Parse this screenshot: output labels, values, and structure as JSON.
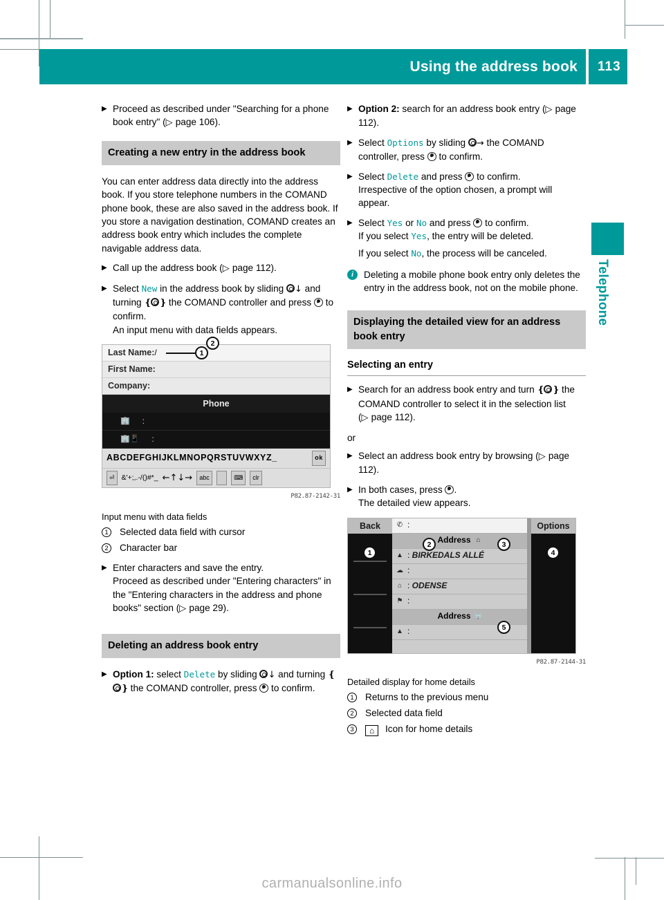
{
  "header": {
    "title": "Using the address book",
    "page_number": "113",
    "accent_color": "#009999"
  },
  "side_tab": {
    "label": "Telephone"
  },
  "watermark": "carmanualsonline.info",
  "left_column": {
    "step_proceed": {
      "line1": "Proceed as described under \"Searching for",
      "line2_pre": "a phone book entry\" (",
      "ref": "page 106",
      "line2_post": ")."
    },
    "section_create": "Creating a new entry in the address book",
    "intro_paragraph": "You can enter address data directly into the address book. If you store telephone numbers in the COMAND phone book, these are also saved in the address book. If you store a navigation destination, COMAND creates an address book entry which includes the complete navigable address data.",
    "step_callup_pre": "Call up the address book (",
    "step_callup_ref": "page 112",
    "step_callup_post": ").",
    "step_new": {
      "pre": "Select ",
      "keyword": "New",
      "mid1": " in the address book by sliding ",
      "mid2": " and turning ",
      "mid3": " the COMAND controller and press ",
      "post": " to confirm.",
      "result": "An input menu with data fields appears."
    },
    "figure1": {
      "fields": [
        "Last Name:",
        "First Name:",
        "Company:"
      ],
      "band_label": "Phone",
      "alpha_row": "ABCDEFGHIJKLMNOPQRSTUVWXYZ_",
      "alpha_cursor": "M",
      "ok_key": "ok",
      "sym_row": "&'+;,.-/()#*_",
      "abc_key": "abc",
      "clr_key": "clr",
      "image_id": "P82.87-2142-31",
      "caption": "Input menu with data fields",
      "legend": [
        {
          "num": "1",
          "text": "Selected data field with cursor"
        },
        {
          "num": "2",
          "text": "Character bar"
        }
      ]
    },
    "step_enter": {
      "line1": "Enter characters and save the entry.",
      "line2": "Proceed as described under \"Entering characters\" in the \"Entering characters in the address and phone books\" section (",
      "ref": "page 29",
      "line3": ")."
    },
    "section_delete": "Deleting an address book entry",
    "step_option1": {
      "label": "Option 1:",
      "pre": " select ",
      "keyword": "Delete",
      "mid1": " by sliding ",
      "mid2": " and turning ",
      "mid3": " the COMAND controller, press ",
      "post": " to confirm."
    }
  },
  "right_column": {
    "step_option2": {
      "label": "Option 2:",
      "pre": " search for an address book entry (",
      "ref": "page 112",
      "post": ")."
    },
    "step_options": {
      "pre": "Select ",
      "keyword": "Options",
      "mid1": " by sliding ",
      "mid2": " the COMAND controller, press ",
      "post": " to confirm."
    },
    "step_delete": {
      "pre": "Select ",
      "keyword": "Delete",
      "mid": " and press ",
      "post": " to confirm.",
      "result": "Irrespective of the option chosen, a prompt will appear."
    },
    "step_yesno": {
      "pre": "Select ",
      "yes": "Yes",
      "or": " or ",
      "no": "No",
      "mid": " and press ",
      "post": " to confirm.",
      "line2_pre": "If you select ",
      "line2_post": ", the entry will be deleted.",
      "line3_pre": "If you select ",
      "line3_post": ", the process will be canceled."
    },
    "info_note": "Deleting a mobile phone book entry only deletes the entry in the address book, not on the mobile phone.",
    "section_detailed": "Displaying the detailed view for an address book entry",
    "sub_selecting": "Selecting an entry",
    "step_search": {
      "line1": "Search for an address book entry and turn",
      "mid": " the COMAND controller to select it in the selection list (",
      "ref": "page 112",
      "post": ")."
    },
    "or_text": "or",
    "step_browse": {
      "pre": "Select an address book entry by browsing (",
      "ref": "page 112",
      "post": ")."
    },
    "step_bothcases": {
      "pre": "In both cases, press ",
      "post": ".",
      "result": "The detailed view appears."
    },
    "figure2": {
      "back_label": "Back",
      "options_label": "Options",
      "address_label_top": "Address",
      "address_label_bottom": "Address",
      "street_value": "BIRKEDALS ALLÉ",
      "city_value": "ODENSE",
      "image_id": "P82.87-2144-31",
      "caption": "Detailed display for home details",
      "legend": [
        {
          "num": "1",
          "text": "Returns to the previous menu"
        },
        {
          "num": "2",
          "text": "Selected data field"
        },
        {
          "num": "3",
          "text": "Icon for home details",
          "icon": "home-icon"
        }
      ]
    }
  }
}
